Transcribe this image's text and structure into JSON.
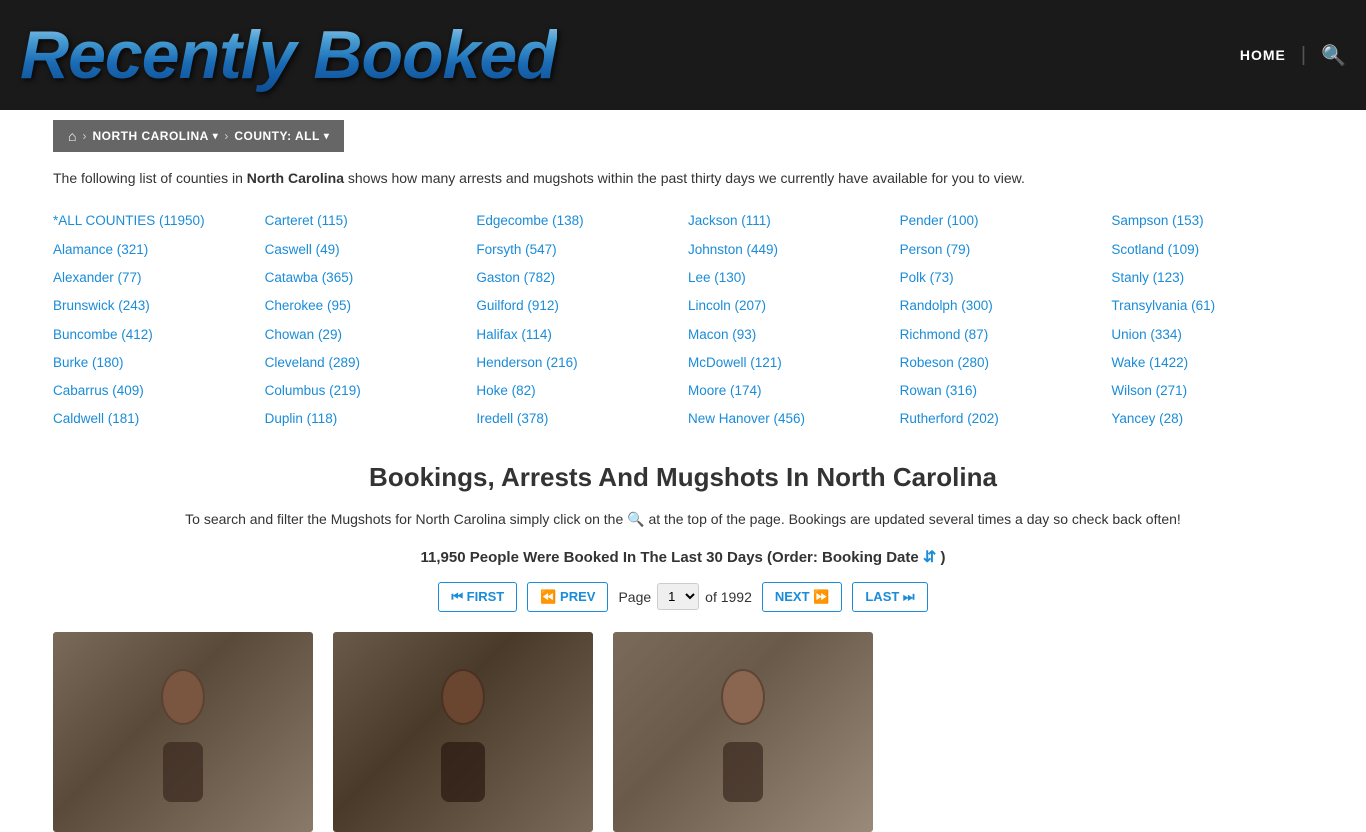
{
  "header": {
    "logo": "Recently Booked",
    "nav": {
      "home_label": "HOME"
    }
  },
  "breadcrumb": {
    "home_icon": "⌂",
    "state": "NORTH CAROLINA",
    "county": "COUNTY: ALL"
  },
  "intro": {
    "text_before": "The following list of counties in ",
    "state_bold": "North Carolina",
    "text_after": " shows how many arrests and mugshots within the past thirty days we currently have available for you to view."
  },
  "counties": [
    "*ALL COUNTIES (11950)",
    "Carteret (115)",
    "Edgecombe (138)",
    "Jackson (111)",
    "Pender (100)",
    "Sampson (153)",
    "Alamance (321)",
    "Caswell (49)",
    "Forsyth (547)",
    "Johnston (449)",
    "Person (79)",
    "Scotland (109)",
    "Alexander (77)",
    "Catawba (365)",
    "Gaston (782)",
    "Lee (130)",
    "Polk (73)",
    "Stanly (123)",
    "Brunswick (243)",
    "Cherokee (95)",
    "Guilford (912)",
    "Lincoln (207)",
    "Randolph (300)",
    "Transylvania (61)",
    "Buncombe (412)",
    "Chowan (29)",
    "Halifax (114)",
    "Macon (93)",
    "Richmond (87)",
    "Union (334)",
    "Burke (180)",
    "Cleveland (289)",
    "Henderson (216)",
    "McDowell (121)",
    "Robeson (280)",
    "Wake (1422)",
    "Cabarrus (409)",
    "Columbus (219)",
    "Hoke (82)",
    "Moore (174)",
    "Rowan (316)",
    "Wilson (271)",
    "Caldwell (181)",
    "Duplin (118)",
    "Iredell (378)",
    "New Hanover (456)",
    "Rutherford (202)",
    "Yancey (28)"
  ],
  "section": {
    "heading": "Bookings, Arrests And Mugshots In North Carolina",
    "description_1": "To search and filter the Mugshots for North Carolina simply click on the",
    "description_2": "at the top of the page. Bookings are updated several times a day so check back often!",
    "booking_count_text": "11,950 People Were Booked In The Last 30 Days (Order: Booking Date",
    "booking_count_end": ")"
  },
  "pagination": {
    "first_label": "⏮ FIRST",
    "prev_label": "⏪ PREV",
    "page_label": "Page",
    "page_current": "1",
    "page_total": "of 1992",
    "next_label": "NEXT ⏩",
    "last_label": "LAST ⏭"
  }
}
